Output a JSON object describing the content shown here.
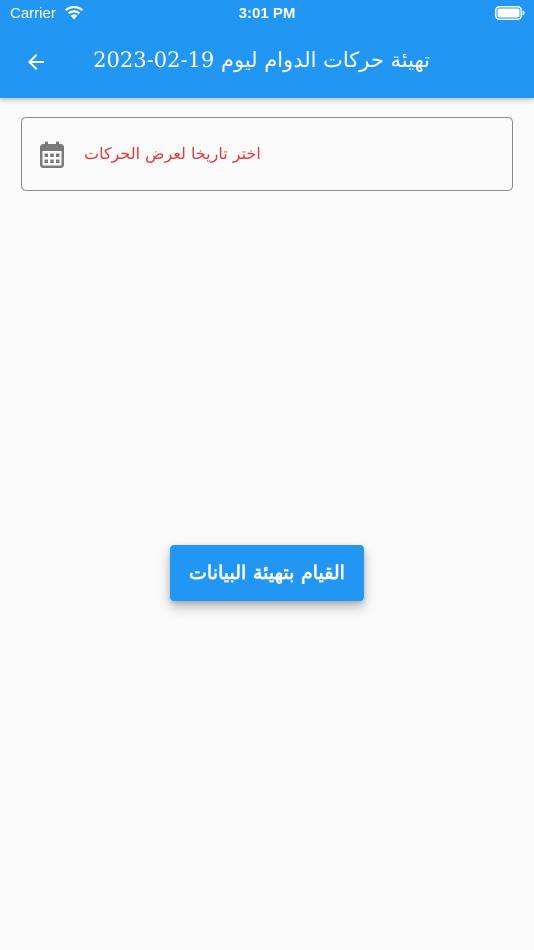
{
  "status_bar": {
    "carrier": "Carrier",
    "time": "3:01 PM"
  },
  "app_bar": {
    "title": "تهيئة حركات الدوام ليوم 19-02-2023"
  },
  "date_field": {
    "hint": "اختر تاريخا لعرض الحركات"
  },
  "actions": {
    "init_label": "القيام بتهيئة البيانات"
  },
  "colors": {
    "primary": "#2196f3",
    "hint_text": "#e53935",
    "background": "#fafafa",
    "field_border": "#8a8a8a"
  },
  "icons": {
    "back": "arrow-left-icon",
    "calendar": "calendar-icon",
    "wifi": "wifi-icon",
    "battery": "battery-icon"
  }
}
